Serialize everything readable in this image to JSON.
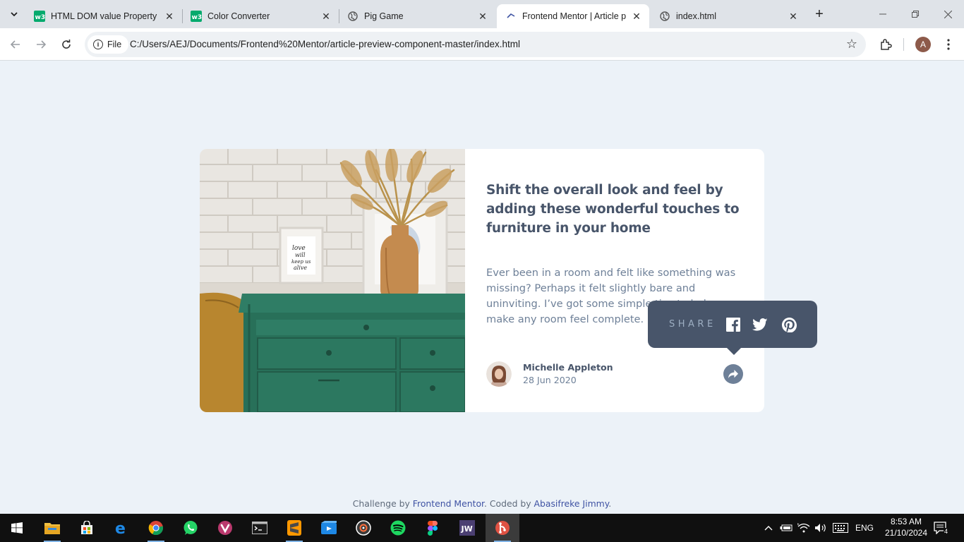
{
  "browser": {
    "tabs": [
      {
        "title": "HTML DOM value Property",
        "favicon": "w3schools-icon"
      },
      {
        "title": "Color Converter",
        "favicon": "w3schools-icon"
      },
      {
        "title": "Pig Game",
        "favicon": "globe-icon"
      },
      {
        "title": "Frontend Mentor | Article pr",
        "favicon": "frontend-mentor-icon",
        "active": true
      },
      {
        "title": "index.html",
        "favicon": "globe-icon"
      }
    ],
    "site_chip": "File",
    "url": "C:/Users/AEJ/Documents/Frontend%20Mentor/article-preview-component-master/index.html",
    "profile_initial": "A"
  },
  "article": {
    "headline": "Shift the overall look and feel by adding these wonderful touches to furniture in your home",
    "description": "Ever been in a room and felt like something was missing? Perhaps it felt slightly bare and uninviting. I’ve got some simple tips to help you make any room feel complete.",
    "author_name": "Michelle Appleton",
    "date": "28 Jun 2020",
    "frame_text": "love will keep us alive"
  },
  "share_popup": {
    "label": "SHARE",
    "icons": [
      "facebook-icon",
      "twitter-icon",
      "pinterest-icon"
    ]
  },
  "attribution": {
    "prefix": "Challenge by ",
    "link1": "Frontend Mentor",
    "middle": ". Coded by ",
    "link2": "Abasifreke Jimmy",
    "suffix": "."
  },
  "taskbar": {
    "apps": [
      "start-icon",
      "file-explorer-icon",
      "store-icon",
      "edge-icon",
      "chrome-icon",
      "whatsapp-icon",
      "vivaldi-icon",
      "terminal-icon",
      "sublime-text-icon",
      "video-editor-icon",
      "music-player-icon",
      "spotify-icon",
      "figma-icon",
      "jw-library-icon",
      "git-app-icon"
    ],
    "language": "ENG",
    "time": "8:53 AM",
    "date": "21/10/2024",
    "notifications": "4"
  },
  "colors": {
    "page_bg": "#ecf2f8",
    "card_bg": "#ffffff",
    "dark_blue": "#48556a",
    "grayish_blue": "#6e8098",
    "light_blue": "#9daec2",
    "dresser_green": "#2e7a62"
  }
}
